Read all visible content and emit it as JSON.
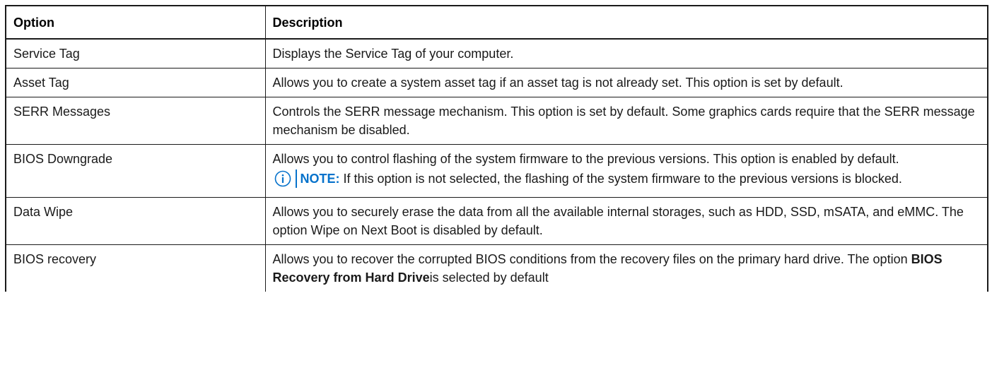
{
  "table": {
    "headers": [
      "Option",
      "Description"
    ],
    "rows": [
      {
        "option": "Service Tag",
        "description": "Displays the Service Tag of your computer."
      },
      {
        "option": "Asset Tag",
        "description": "Allows you to create a system asset tag if an asset tag is not already set. This option is set by default."
      },
      {
        "option": "SERR Messages",
        "description": "Controls the SERR message mechanism. This option is set by default. Some graphics cards require that the SERR message mechanism be disabled."
      },
      {
        "option": "BIOS Downgrade",
        "description": "Allows you to control flashing of the system firmware to the previous versions. This option is enabled by default.",
        "note_label": "NOTE:",
        "note_text": " If this option is not selected, the flashing of the system firmware to the previous versions is blocked."
      },
      {
        "option": "Data Wipe",
        "description": "Allows you to securely erase the data from all the available internal storages, such as HDD, SSD, mSATA, and eMMC. The option Wipe on Next Boot is disabled by default."
      },
      {
        "option": "BIOS recovery",
        "description_pre": "Allows you to recover the corrupted BIOS conditions from the recovery files on the primary hard drive. The option ",
        "description_bold": "BIOS Recovery from Hard Drive",
        "description_post": "is selected by default"
      }
    ]
  },
  "icons": {
    "note": "info-circle-icon"
  },
  "colors": {
    "note_accent": "#0672cb",
    "border": "#1a1a1a",
    "text": "#1a1a1a"
  }
}
